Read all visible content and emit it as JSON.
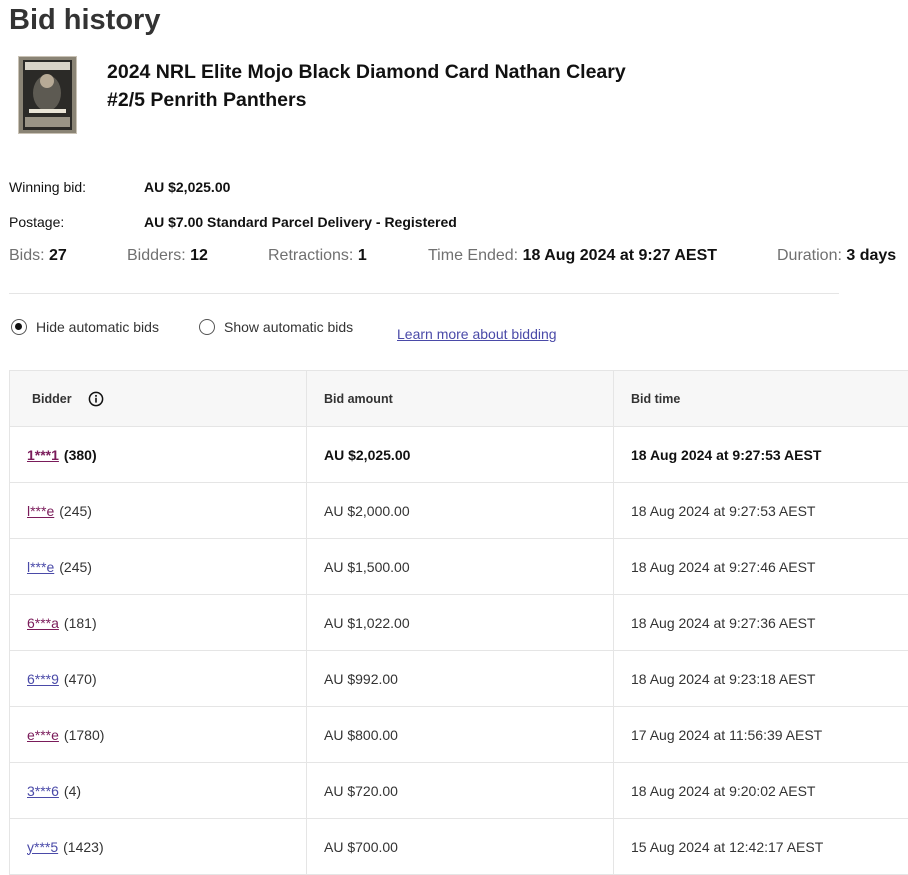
{
  "page": {
    "title": "Bid history"
  },
  "item": {
    "title_line1": "2024 NRL Elite Mojo Black Diamond Card Nathan Cleary",
    "title_line2": "#2/5 Penrith Panthers"
  },
  "summary": {
    "winning_bid_label": "Winning bid:",
    "winning_bid_value": "AU $2,025.00",
    "postage_label": "Postage:",
    "postage_value": "AU $7.00 Standard Parcel Delivery - Registered"
  },
  "stats": {
    "bids_label": "Bids:",
    "bids_value": "27",
    "bidders_label": "Bidders:",
    "bidders_value": "12",
    "retractions_label": "Retractions:",
    "retractions_value": "1",
    "time_ended_label": "Time Ended:",
    "time_ended_value": "18 Aug 2024 at 9:27 AEST",
    "duration_label": "Duration:",
    "duration_value": "3 days"
  },
  "filters": {
    "hide_label": "Hide automatic bids",
    "show_label": "Show automatic bids",
    "selected": "hide",
    "learn_more": "Learn more about bidding"
  },
  "table": {
    "headers": {
      "bidder": "Bidder",
      "amount": "Bid amount",
      "time": "Bid time"
    },
    "rows": [
      {
        "bidder": "1***1",
        "score": "(380)",
        "amount": "AU $2,025.00",
        "time": "18 Aug 2024 at 9:27:53 AEST"
      },
      {
        "bidder": "l***e",
        "score": "(245)",
        "amount": "AU $2,000.00",
        "time": "18 Aug 2024 at 9:27:53 AEST"
      },
      {
        "bidder": "l***e",
        "score": "(245)",
        "amount": "AU $1,500.00",
        "time": "18 Aug 2024 at 9:27:46 AEST"
      },
      {
        "bidder": "6***a",
        "score": "(181)",
        "amount": "AU $1,022.00",
        "time": "18 Aug 2024 at 9:27:36 AEST"
      },
      {
        "bidder": "6***9",
        "score": "(470)",
        "amount": "AU $992.00",
        "time": "18 Aug 2024 at 9:23:18 AEST"
      },
      {
        "bidder": "e***e",
        "score": "(1780)",
        "amount": "AU $800.00",
        "time": "17 Aug 2024 at 11:56:39 AEST"
      },
      {
        "bidder": "3***6",
        "score": "(4)",
        "amount": "AU $720.00",
        "time": "18 Aug 2024 at 9:20:02 AEST"
      },
      {
        "bidder": "y***5",
        "score": "(1423)",
        "amount": "AU $700.00",
        "time": "15 Aug 2024 at 12:42:17 AEST"
      }
    ]
  },
  "colors": {
    "link": "#4a4aa8",
    "visited_link": "#7a1b5a",
    "header_bg": "#f7f7f7"
  },
  "icons": {
    "info": "info-circle-icon"
  }
}
